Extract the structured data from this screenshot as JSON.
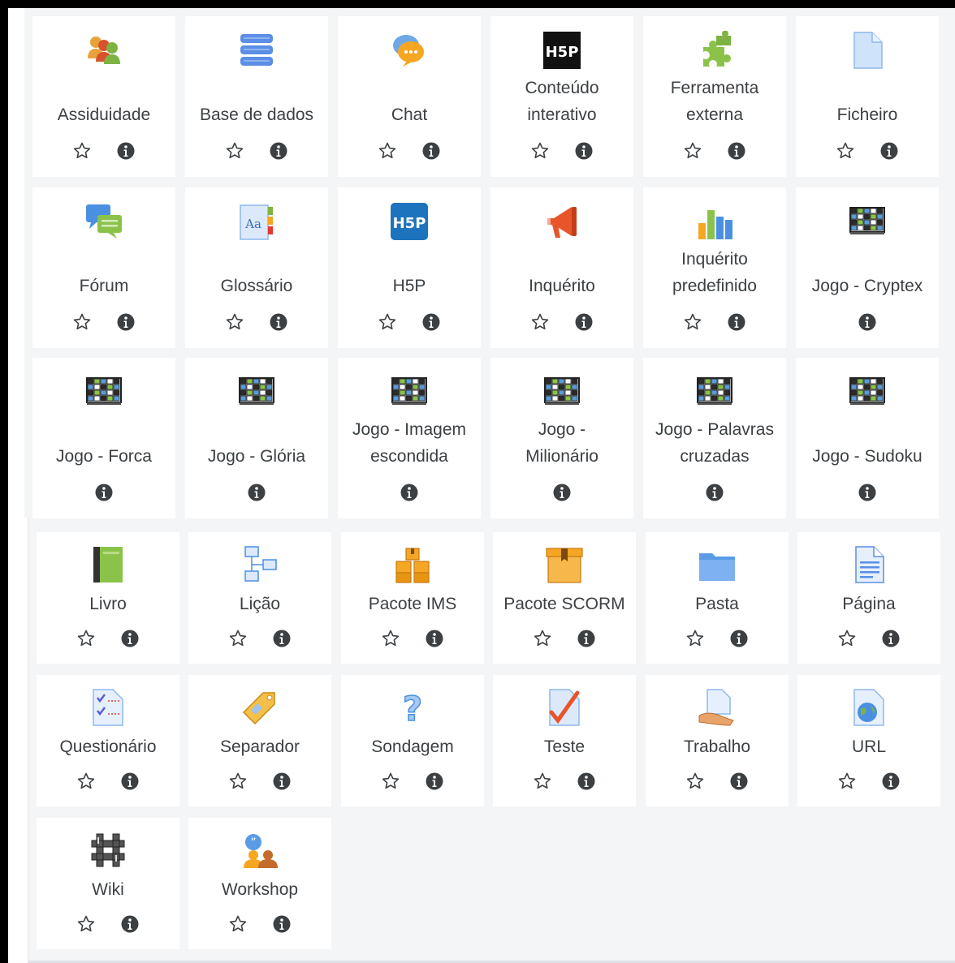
{
  "tiles": [
    {
      "name": "Assiduidade",
      "icon": "attendance-icon",
      "starred": false,
      "star": true
    },
    {
      "name": "Base de dados",
      "icon": "database-icon",
      "starred": false,
      "star": true
    },
    {
      "name": "Chat",
      "icon": "chat-icon",
      "starred": false,
      "star": true
    },
    {
      "name": "Conteúdo interativo",
      "line1": "Conteúdo",
      "line2": "interativo",
      "icon": "h5p-dark-icon",
      "star": true
    },
    {
      "name": "Ferramenta externa",
      "line1": "Ferramenta",
      "line2": "externa",
      "icon": "puzzle-icon",
      "star": true
    },
    {
      "name": "Ficheiro",
      "icon": "file-icon",
      "star": true
    },
    {
      "name": "Fórum",
      "icon": "forum-icon",
      "star": true
    },
    {
      "name": "Glossário",
      "icon": "glossary-icon",
      "star": true
    },
    {
      "name": "H5P",
      "icon": "h5p-blue-icon",
      "star": true
    },
    {
      "name": "Inquérito",
      "icon": "megaphone-icon",
      "star": true
    },
    {
      "name": "Inquérito predefinido",
      "line1": "Inquérito",
      "line2": "predefinido",
      "icon": "bar-chart-icon",
      "star": true
    },
    {
      "name": "Jogo - Cryptex",
      "icon": "game-icon",
      "star": false
    },
    {
      "name": "Jogo - Forca",
      "icon": "game-icon",
      "star": false
    },
    {
      "name": "Jogo - Glória",
      "icon": "game-icon",
      "star": false
    },
    {
      "name": "Jogo - Imagem escondida",
      "line1": "Jogo - Imagem",
      "line2": "escondida",
      "icon": "game-icon",
      "star": false
    },
    {
      "name": "Jogo - Milionário",
      "line1": "Jogo -",
      "line2": "Milionário",
      "icon": "game-icon",
      "star": false
    },
    {
      "name": "Jogo - Palavras cruzadas",
      "line1": "Jogo - Palavras",
      "line2": "cruzadas",
      "icon": "game-icon",
      "star": false
    },
    {
      "name": "Jogo - Sudoku",
      "icon": "game-icon",
      "star": false
    },
    {
      "name": "Livro",
      "icon": "book-icon",
      "star": true
    },
    {
      "name": "Lição",
      "icon": "lesson-icon",
      "star": true
    },
    {
      "name": "Pacote IMS",
      "icon": "ims-package-icon",
      "star": true
    },
    {
      "name": "Pacote SCORM",
      "icon": "scorm-package-icon",
      "star": true
    },
    {
      "name": "Pasta",
      "icon": "folder-icon",
      "star": true
    },
    {
      "name": "Página",
      "icon": "page-icon",
      "star": true
    },
    {
      "name": "Questionário",
      "icon": "questionnaire-icon",
      "star": true
    },
    {
      "name": "Separador",
      "icon": "label-tag-icon",
      "star": true
    },
    {
      "name": "Sondagem",
      "icon": "question-mark-icon",
      "star": true
    },
    {
      "name": "Teste",
      "icon": "quiz-check-icon",
      "star": true
    },
    {
      "name": "Trabalho",
      "icon": "assignment-hand-icon",
      "star": true
    },
    {
      "name": "URL",
      "icon": "url-globe-icon",
      "star": true
    },
    {
      "name": "Wiki",
      "icon": "wiki-icon",
      "star": true
    },
    {
      "name": "Workshop",
      "icon": "workshop-icon",
      "star": true
    }
  ],
  "action_icons": {
    "star": "star-outline-icon",
    "info": "info-circle-icon"
  },
  "colors": {
    "tile_bg": "#ffffff",
    "panel_bg": "#f4f5f7",
    "text": "#3c4043",
    "icon_dark": "#3c4043"
  }
}
